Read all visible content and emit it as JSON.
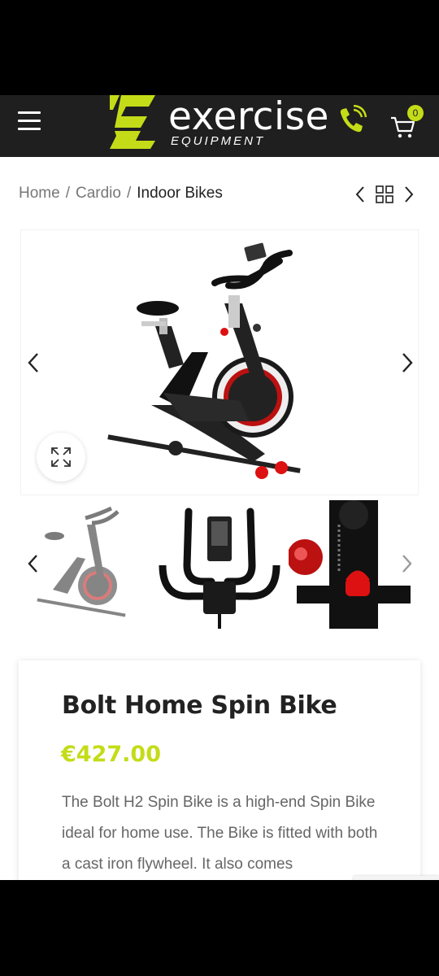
{
  "header": {
    "logo_word": "exercise",
    "logo_sub": "EQUIPMENT",
    "cart_count": "0",
    "accent_color": "#c4dc18",
    "icons": [
      "menu-icon",
      "phone-icon",
      "cart-icon"
    ]
  },
  "breadcrumb": {
    "items": [
      "Home",
      "Cardio"
    ],
    "current": "Indoor Bikes",
    "separator": "/"
  },
  "gallery": {
    "main_image": "black spin bike with red flywheel",
    "thumbnails": [
      "spin bike side view",
      "handlebar and console",
      "resistance knob detail"
    ],
    "selected_index": 0
  },
  "product": {
    "title": "Bolt Home Spin Bike",
    "price": "€427.00",
    "description": "The Bolt H2 Spin Bike is a high-end Spin Bike ideal for home use. The Bike is fitted with both a cast iron flywheel. It also comes"
  }
}
